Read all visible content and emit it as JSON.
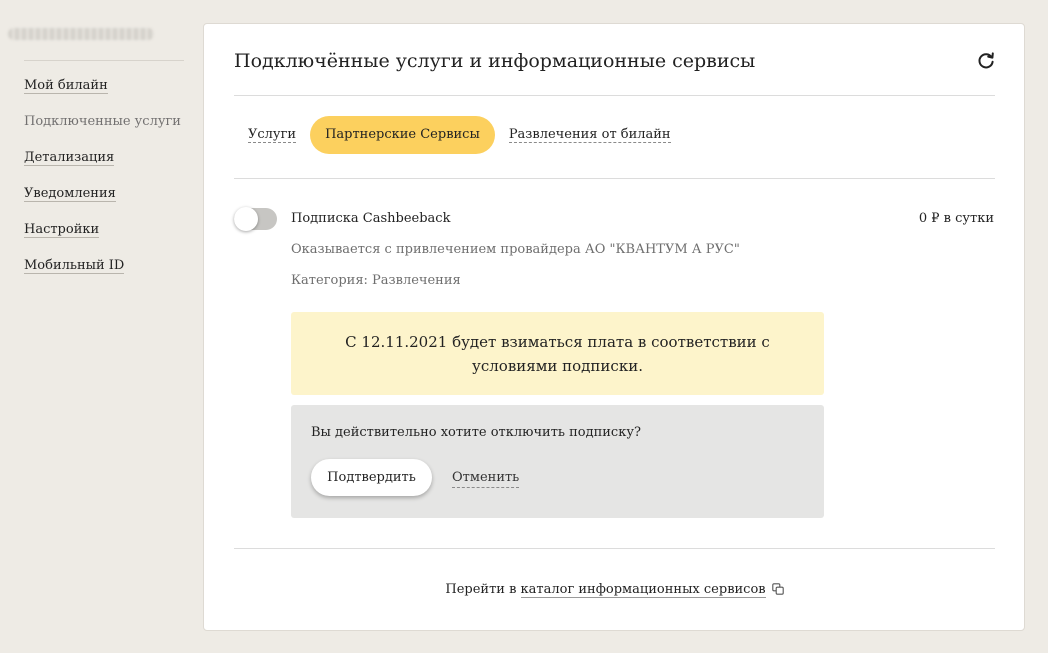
{
  "sidebar": {
    "items": [
      {
        "label": "Мой билайн",
        "active": false
      },
      {
        "label": "Подключенные услуги",
        "active": true
      },
      {
        "label": "Детализация",
        "active": false
      },
      {
        "label": "Уведомления",
        "active": false
      },
      {
        "label": "Настройки",
        "active": false
      },
      {
        "label": "Мобильный ID",
        "active": false
      }
    ]
  },
  "main": {
    "title": "Подключённые услуги и информационные сервисы",
    "refresh_icon": "refresh-icon",
    "tabs": [
      {
        "label": "Услуги",
        "active": false
      },
      {
        "label": "Партнерские Сервисы",
        "active": true
      },
      {
        "label": "Развлечения от билайн",
        "active": false
      }
    ],
    "service": {
      "enabled": false,
      "name": "Подписка Cashbeeback",
      "price": "0 ₽ в сутки",
      "provider": "Оказывается с привлечением провайдера АО \"КВАНТУМ А РУС\"",
      "category": "Категория: Развлечения"
    },
    "notice": {
      "text": "С 12.11.2021 будет взиматься плата в соответствии с условиями подписки.",
      "background": "#fdf4cb"
    },
    "confirm": {
      "question": "Вы действительно хотите отключить подписку?",
      "confirm_label": "Подтвердить",
      "cancel_label": "Отменить"
    },
    "footer": {
      "prefix": "Перейти в",
      "link_label": "каталог информационных сервисов",
      "link_icon": "external-link-icon"
    }
  },
  "colors": {
    "accent": "#fcd05e",
    "page_background": "#eeebe5",
    "card_background": "#ffffff"
  }
}
